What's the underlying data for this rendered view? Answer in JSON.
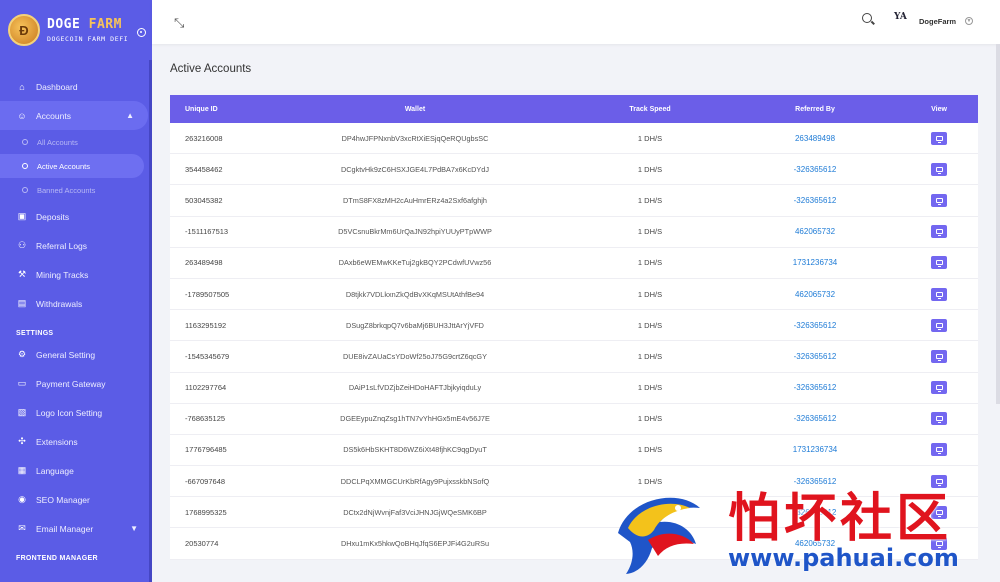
{
  "brand": {
    "title_main": "DOGE",
    "title_accent": "FARM",
    "subtitle": "DOGECOIN FARM DEFI"
  },
  "sidebar": {
    "items": [
      {
        "label": "Dashboard",
        "icon": "home-icon"
      },
      {
        "label": "Accounts",
        "icon": "users-icon",
        "open": true,
        "children": [
          {
            "label": "All Accounts"
          },
          {
            "label": "Active Accounts",
            "active": true
          },
          {
            "label": "Banned Accounts"
          }
        ]
      },
      {
        "label": "Deposits",
        "icon": "wallet-icon"
      },
      {
        "label": "Referral Logs",
        "icon": "referral-icon"
      },
      {
        "label": "Mining Tracks",
        "icon": "pickaxe-icon"
      },
      {
        "label": "Withdrawals",
        "icon": "cash-icon"
      }
    ],
    "settings_heading": "SETTINGS",
    "settings": [
      {
        "label": "General Setting",
        "icon": "gear-icon"
      },
      {
        "label": "Payment Gateway",
        "icon": "card-icon"
      },
      {
        "label": "Logo Icon Setting",
        "icon": "image-icon"
      },
      {
        "label": "Extensions",
        "icon": "puzzle-icon"
      },
      {
        "label": "Language",
        "icon": "language-icon"
      },
      {
        "label": "SEO Manager",
        "icon": "globe-icon"
      },
      {
        "label": "Email Manager",
        "icon": "mail-icon"
      }
    ],
    "frontend_heading": "FRONTEND MANAGER"
  },
  "topbar": {
    "user_name": "DogeFarm",
    "user_logo": "YA"
  },
  "page": {
    "title": "Active Accounts"
  },
  "table": {
    "headers": {
      "id": "Unique ID",
      "wallet": "Wallet",
      "speed": "Track Speed",
      "referred": "Referred By",
      "view": "View"
    },
    "rows": [
      {
        "id": "263216008",
        "wallet": "DP4hwJFPNxnbV3xcRtXiESjqQeRQUgbsSC",
        "speed": "1 DH/S",
        "referred": "263489498"
      },
      {
        "id": "354458462",
        "wallet": "DCgktvHk9zC6HSXJGE4L7PdBA7x6KcDYdJ",
        "speed": "1 DH/S",
        "referred": "-326365612"
      },
      {
        "id": "503045382",
        "wallet": "DTmS8FX8zMH2cAuHmrERz4a2Sxf6afghjh",
        "speed": "1 DH/S",
        "referred": "-326365612"
      },
      {
        "id": "-1511167513",
        "wallet": "D5VCsnuBkrMm6UrQaJN92hpiYUUyPTpWWP",
        "speed": "1 DH/S",
        "referred": "462065732"
      },
      {
        "id": "263489498",
        "wallet": "DAxb6eWEMwKKeTuj2gkBQY2PCdwfUVwz56",
        "speed": "1 DH/S",
        "referred": "1731236734"
      },
      {
        "id": "-1789507505",
        "wallet": "D8tjkk7VDLkxnZkQdBvXKqMSUtAthfBe94",
        "speed": "1 DH/S",
        "referred": "462065732"
      },
      {
        "id": "1163295192",
        "wallet": "DSugZ8brkqpQ7v6baMj6BUH3JttArYjVFD",
        "speed": "1 DH/S",
        "referred": "-326365612"
      },
      {
        "id": "-1545345679",
        "wallet": "DUE8ivZAUaCsYDoWf25oJ75G9crtZ6qcGY",
        "speed": "1 DH/S",
        "referred": "-326365612"
      },
      {
        "id": "1102297764",
        "wallet": "DAiP1sLfVDZjbZeiHDoHAFTJbjkyiqduLy",
        "speed": "1 DH/S",
        "referred": "-326365612"
      },
      {
        "id": "-768635125",
        "wallet": "DGEEypuZnqZsg1hTN7vYhHGx5mE4v56J7E",
        "speed": "1 DH/S",
        "referred": "-326365612"
      },
      {
        "id": "1776796485",
        "wallet": "DS5k6HbSKHT8D6WZ6iXt48fjhKC9qgDyuT",
        "speed": "1 DH/S",
        "referred": "1731236734"
      },
      {
        "id": "-667097648",
        "wallet": "DDCLPqXMMGCUrKbRfAgy9PujxsskbNSofQ",
        "speed": "1 DH/S",
        "referred": "-326365612"
      },
      {
        "id": "1768995325",
        "wallet": "DCtx2dNjWvnjFaf3VciJHNJGjWQeSMK6BP",
        "speed": "1 DH/S",
        "referred": "-326365612"
      },
      {
        "id": "20530774",
        "wallet": "DHxu1mKx5hkwQoBHqJfqS6EPJFi4G2uRSu",
        "speed": "1 DH/S",
        "referred": "462065732"
      }
    ]
  },
  "watermark": {
    "cn_text": "怕坏社区",
    "url": "www.pahuai.com"
  },
  "colors": {
    "sidebar": "#5b5ce6",
    "header": "#6b5ee8",
    "link": "#1e7bd6",
    "button": "#7367f0",
    "watermark_red": "#e0141e",
    "watermark_blue": "#1f55c8"
  }
}
